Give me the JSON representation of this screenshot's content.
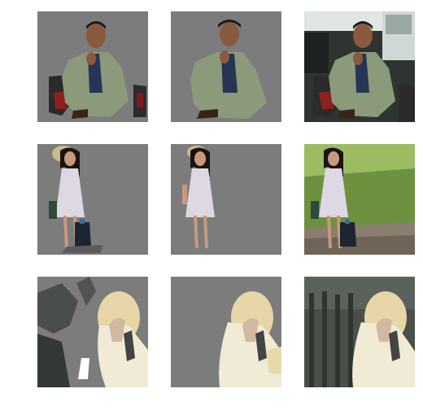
{
  "figure": {
    "rows": [
      {
        "subject": "man-in-suit",
        "tiles": [
          {
            "variant": "mask-a"
          },
          {
            "variant": "mask-b"
          },
          {
            "variant": "original"
          }
        ]
      },
      {
        "subject": "woman-in-dress",
        "tiles": [
          {
            "variant": "mask-a"
          },
          {
            "variant": "mask-b"
          },
          {
            "variant": "original"
          }
        ]
      },
      {
        "subject": "blonde-woman",
        "tiles": [
          {
            "variant": "mask-a"
          },
          {
            "variant": "mask-b"
          },
          {
            "variant": "original"
          }
        ]
      }
    ]
  },
  "colors": {
    "background_gray": "#7c7c7c",
    "suit_green": "#8a9a7a",
    "skin": "#8a5a3e",
    "dress": "#ddd8e2",
    "hair_blonde": "#e6d6a8",
    "grass": "#7fa24a",
    "dark_bg": "#2e3430"
  }
}
